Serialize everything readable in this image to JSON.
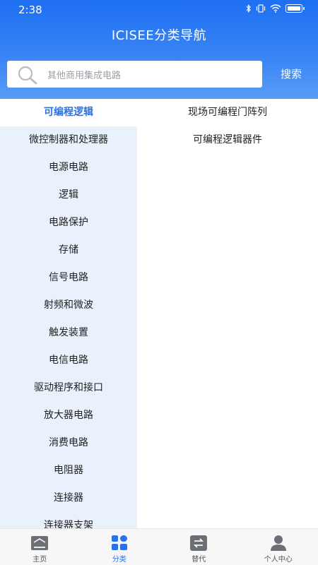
{
  "status_bar": {
    "time": "2:38"
  },
  "header": {
    "title": "ICISEE分类导航"
  },
  "search": {
    "placeholder": "其他商用集成电路",
    "button_label": "搜索"
  },
  "categories": [
    {
      "label": "可编程逻辑",
      "active": true
    },
    {
      "label": "微控制器和处理器"
    },
    {
      "label": "电源电路"
    },
    {
      "label": "逻辑"
    },
    {
      "label": "电路保护"
    },
    {
      "label": "存储"
    },
    {
      "label": "信号电路"
    },
    {
      "label": "射频和微波"
    },
    {
      "label": "触发装置"
    },
    {
      "label": "电信电路"
    },
    {
      "label": "驱动程序和接口"
    },
    {
      "label": "放大器电路"
    },
    {
      "label": "消费电路"
    },
    {
      "label": "电阻器"
    },
    {
      "label": "连接器"
    },
    {
      "label": "连接器支架"
    }
  ],
  "subcategories": [
    {
      "label": "现场可编程门阵列"
    },
    {
      "label": "可编程逻辑器件"
    }
  ],
  "tabs": [
    {
      "label": "主页",
      "icon": "home-icon"
    },
    {
      "label": "分类",
      "icon": "category-icon",
      "active": true
    },
    {
      "label": "替代",
      "icon": "swap-icon"
    },
    {
      "label": "个人中心",
      "icon": "user-icon"
    }
  ],
  "colors": {
    "accent": "#2a72e8",
    "header_top": "#1e6ff2",
    "left_bg": "#e9f1fd"
  }
}
